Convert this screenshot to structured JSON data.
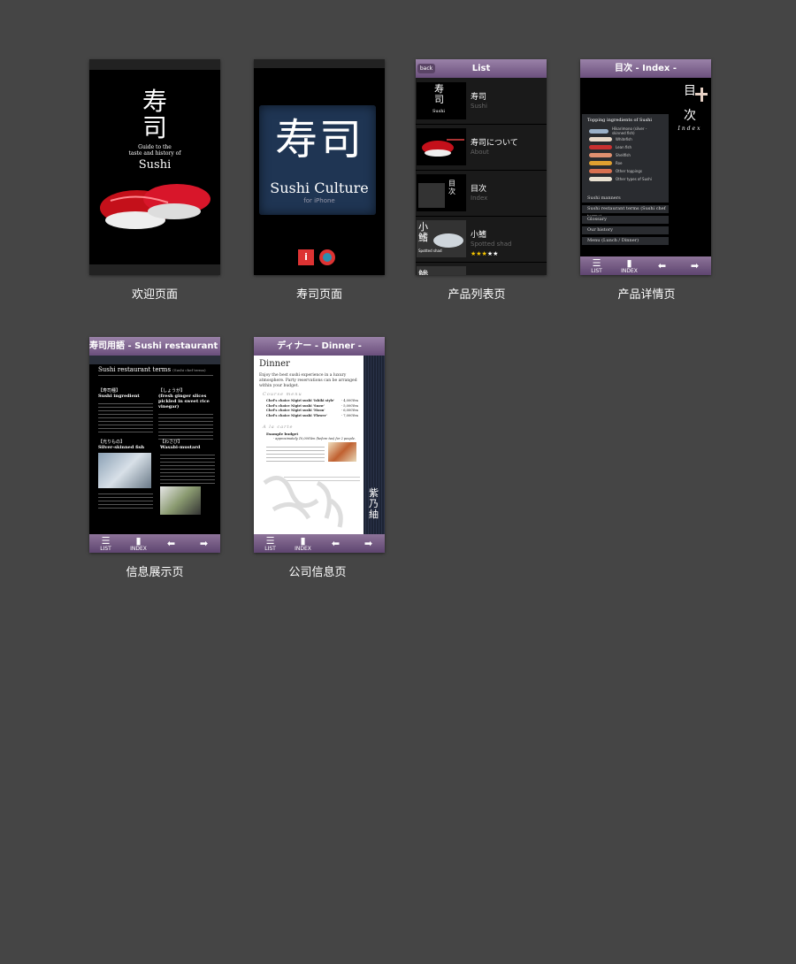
{
  "cards": [
    {
      "caption": "欢迎页面"
    },
    {
      "caption": "寿司页面"
    },
    {
      "caption": "产品列表页"
    },
    {
      "caption": "产品详情页"
    },
    {
      "caption": "信息展示页"
    },
    {
      "caption": "公司信息页"
    }
  ],
  "welcome": {
    "kanji_1": "寿",
    "kanji_2": "司",
    "subtitle_1": "Guide to the",
    "subtitle_2": "taste and history of",
    "sushi": "Sushi"
  },
  "culture": {
    "big": "寿司",
    "name": "Sushi Culture",
    "for": "for iPhone",
    "info_glyph": "i"
  },
  "list": {
    "title": "List",
    "back": "back",
    "rows": [
      {
        "title": "寿司",
        "sub": "Sushi",
        "stars": ""
      },
      {
        "title": "寿司について",
        "sub": "About",
        "stars": ""
      },
      {
        "title": "目次",
        "sub": "Index",
        "stars": ""
      },
      {
        "title": "小鰭",
        "sub": "Spotted shad",
        "stars_on": "★★★",
        "stars_off": "★★"
      }
    ],
    "thumb_1_kanji": "寿司",
    "thumb_1_sub": "Sushi",
    "thumb_3_kanji": "目次",
    "thumb_4_kanji": "小鰭",
    "thumb_4_sub": "Spotted shad",
    "row5_kanji": "鯵"
  },
  "detail": {
    "title": "目次 - Index -",
    "side_1": "目",
    "side_2": "次",
    "side_en": "Index",
    "box_title": "Topping ingredients of Sushi",
    "toppings": [
      {
        "label": "Hikarimono (silver - skinned fish)",
        "color": "#9ab0c8"
      },
      {
        "label": "Whitefish",
        "color": "#e8d8c8"
      },
      {
        "label": "Lean fish",
        "color": "#c83030"
      },
      {
        "label": "Shellfish",
        "color": "#e09070"
      },
      {
        "label": "Roe",
        "color": "#e0a030"
      },
      {
        "label": "Other toppings",
        "color": "#d87050"
      },
      {
        "label": "Other types of Sushi",
        "color": "#e8e0d0"
      }
    ],
    "menu": [
      "Sushi manners",
      "Sushi restaurant terms (Sushi chef terms)",
      "Glossary",
      "Our history",
      "Menu (Lunch / Dinner)"
    ]
  },
  "toolbar": {
    "list": "LIST",
    "index": "INDEX",
    "list_glyph": "☰",
    "index_glyph": "▮",
    "prev_glyph": "⬅",
    "next_glyph": "➡"
  },
  "info": {
    "title": "寿司用語 - Sushi restaurant ter...",
    "heading": "Sushi restaurant terms",
    "heading_sub": "(Sushi chef terms)",
    "col1_head": "【寿司種】",
    "col1_sub": "Sushi ingredient",
    "col2_head": "【しょうが】",
    "col2_sub": "(fresh ginger slices pickled in sweet rice vinegar)",
    "col3_head": "【光りもの】",
    "col3_sub": "Silver-skinned fish",
    "col4_head": "【わさび】",
    "col4_sub": "Wasabi-mustard"
  },
  "company": {
    "title": "ディナー - Dinner -",
    "heading": "Dinner",
    "intro": "Enjoy the best sushi experience in a luxury atmosphere. Party reservations can be arranged within your budget.",
    "course": "Course menu",
    "items": [
      {
        "name": "Chef's choice Nigiri sushi 'Ishiki style'",
        "price": "- 4,000Yen"
      },
      {
        "name": "Chef's choice Nigiri sushi 'Snow'",
        "price": "- 5,000Yen"
      },
      {
        "name": "Chef's choice Nigiri sushi 'Moon'",
        "price": "- 6,000Yen"
      },
      {
        "name": "Chef's choice Nigiri sushi 'Flower'",
        "price": "- 7,000Yen"
      }
    ],
    "alacarte": "A la carte",
    "budget": "Example budget",
    "budget_sub": "- approximately 10,000Yen (before tax) for 2 people.",
    "vertical": "紫乃紬"
  }
}
